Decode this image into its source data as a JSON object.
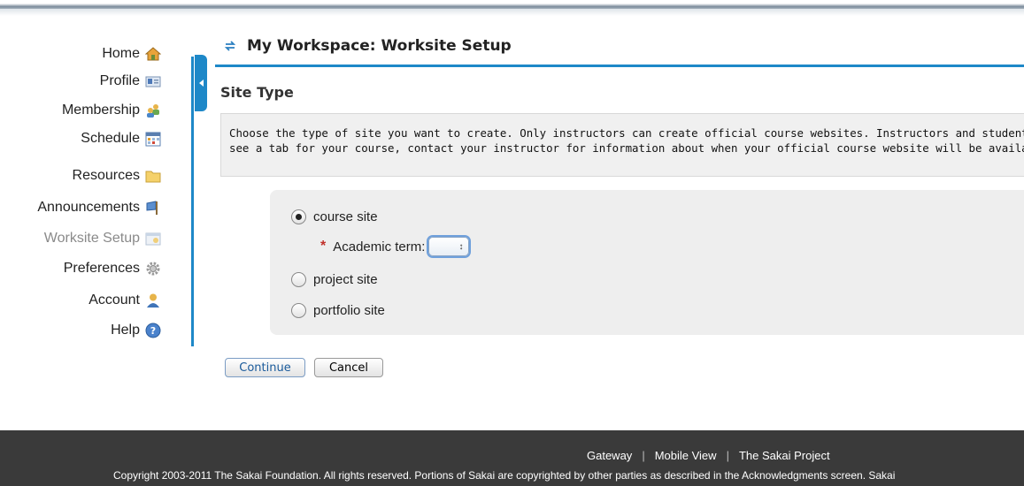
{
  "tool_menu": {
    "items": [
      {
        "label": "Home",
        "icon": "home-icon"
      },
      {
        "label": "Profile",
        "icon": "profile-card-icon"
      },
      {
        "label": "Membership",
        "icon": "membership-icon"
      },
      {
        "label": "Schedule",
        "icon": "calendar-icon"
      },
      {
        "label": "Resources",
        "icon": "folder-icon"
      },
      {
        "label": "Announcements",
        "icon": "announcement-flag-icon"
      },
      {
        "label": "Worksite Setup",
        "icon": "worksite-setup-icon",
        "current": true
      },
      {
        "label": "Preferences",
        "icon": "gear-icon"
      },
      {
        "label": "Account",
        "icon": "user-icon"
      },
      {
        "label": "Help",
        "icon": "help-icon"
      }
    ]
  },
  "header": {
    "title": "My Workspace: Worksite Setup",
    "reset_icon": "reset-arrows-icon"
  },
  "main": {
    "section_title": "Site Type",
    "instructions_line1": "Choose the type of site you want to create. Only instructors can create official course websites. Instructors and students",
    "instructions_line2": "see a tab for your course, contact your instructor for information about when your official course website will be available",
    "options": {
      "course": "course site",
      "project": "project site",
      "portfolio": "portfolio site"
    },
    "selected_option": "course site",
    "required_marker": "*",
    "academic_term_label": "Academic term:",
    "academic_term_value": ""
  },
  "buttons": {
    "continue": "Continue",
    "cancel": "Cancel"
  },
  "footer": {
    "links": [
      "Gateway",
      "Mobile View",
      "The Sakai Project"
    ],
    "separator": "|",
    "copyright": "Copyright 2003-2011 The Sakai Foundation. All rights reserved. Portions of Sakai are copyrighted by other parties as described in the Acknowledgments screen. Sakai"
  },
  "colors": {
    "accent": "#1e88c8",
    "footer_bg": "#3a3a3a",
    "required": "#c0302a"
  }
}
